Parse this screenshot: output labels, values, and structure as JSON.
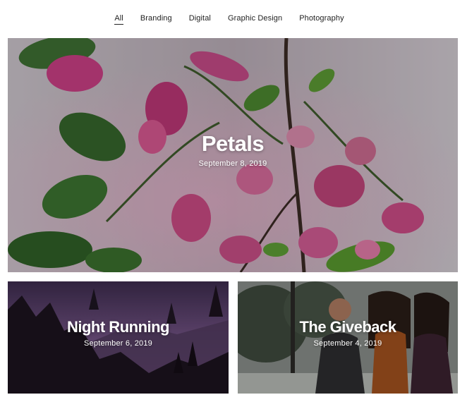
{
  "filters": {
    "items": [
      "All",
      "Branding",
      "Digital",
      "Graphic Design",
      "Photography"
    ],
    "active": "All"
  },
  "posts": [
    {
      "title": "Petals",
      "date": "September 8, 2019"
    },
    {
      "title": "Night Running",
      "date": "September 6, 2019"
    },
    {
      "title": "The Giveback",
      "date": "September 4, 2019"
    }
  ],
  "colors": {
    "nav_text": "#222222",
    "overlay_text": "#ffffff",
    "petal_pink": "#c2407e",
    "leaf_green": "#3f7a2a",
    "dusk_purple": "#6a4a78"
  }
}
